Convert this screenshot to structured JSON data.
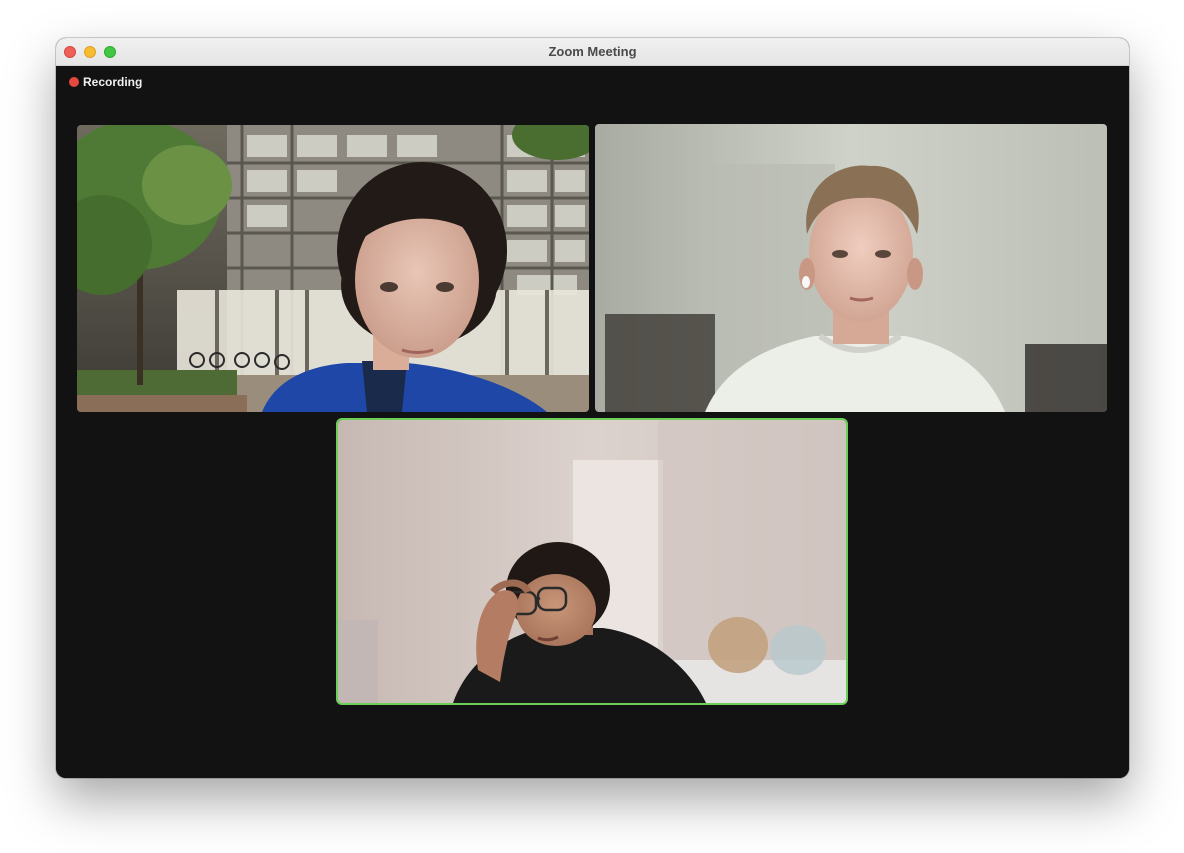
{
  "window": {
    "title": "Zoom Meeting"
  },
  "recording": {
    "label": "Recording",
    "color": "#e5483e"
  },
  "participants": [
    {
      "position": "top-left",
      "background": "building-courtyard",
      "active_speaker": false
    },
    {
      "position": "top-right",
      "background": "blurred-room",
      "active_speaker": false
    },
    {
      "position": "bottom-center",
      "background": "blurred-room",
      "active_speaker": true
    }
  ],
  "colors": {
    "active_speaker_border": "#6ccf58",
    "window_bg": "#121212"
  }
}
